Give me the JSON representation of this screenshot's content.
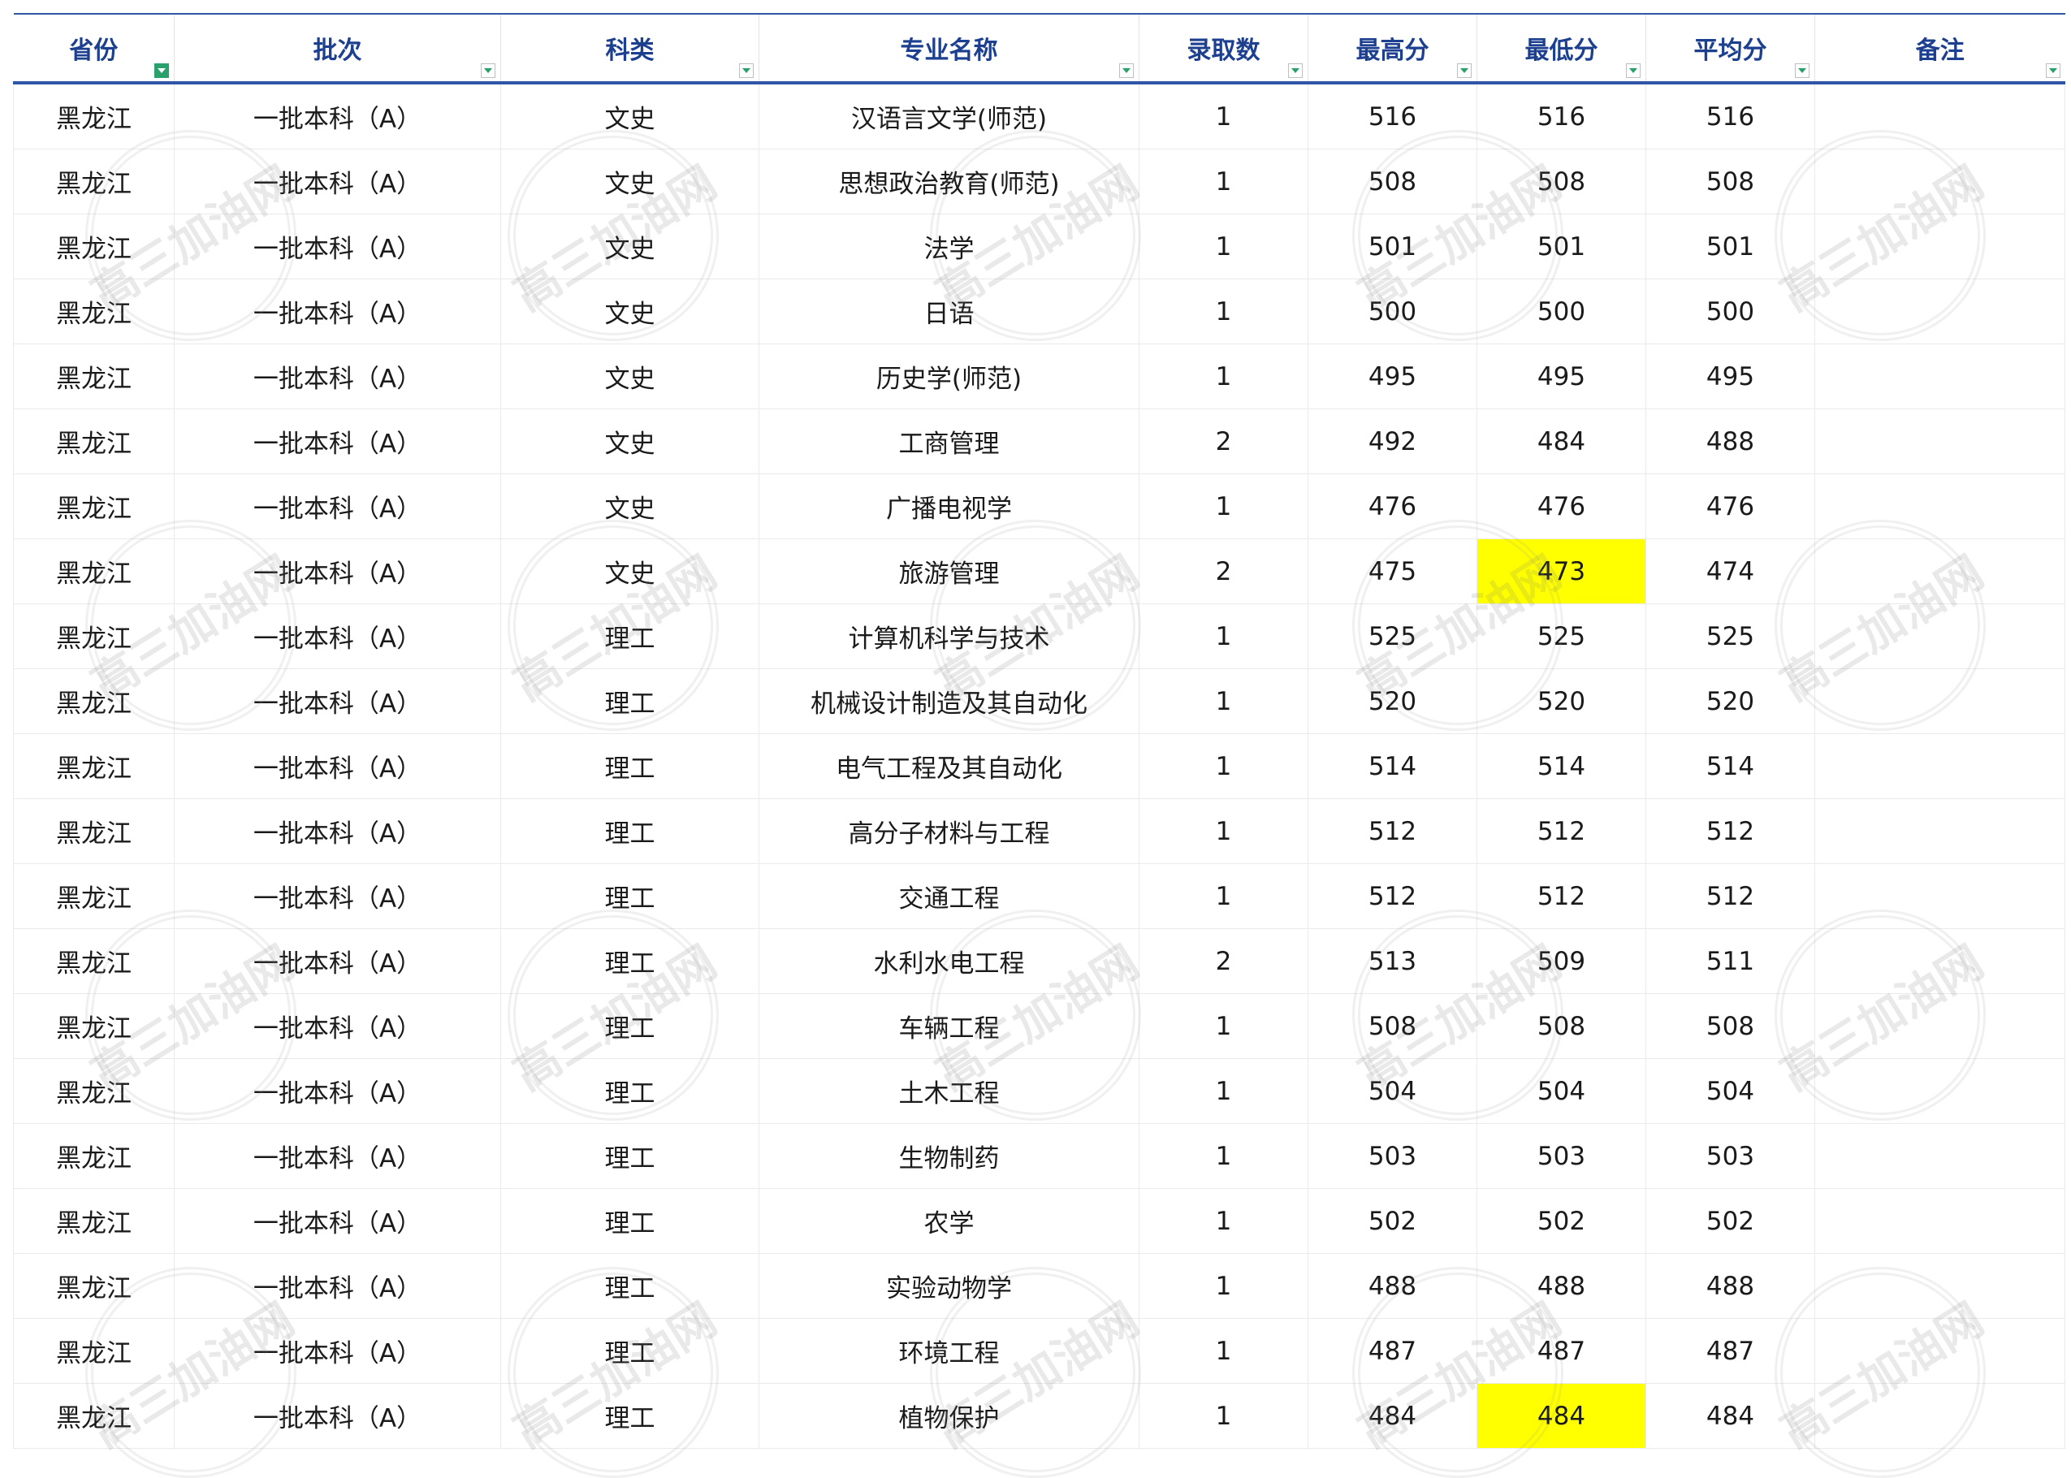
{
  "headers": [
    "省份",
    "批次",
    "科类",
    "专业名称",
    "录取数",
    "最高分",
    "最低分",
    "平均分",
    "备注"
  ],
  "watermark_text": "高三加油网",
  "highlight_color": "#ffff00",
  "rows": [
    {
      "province": "黑龙江",
      "batch": "一批本科（A）",
      "category": "文史",
      "major": "汉语言文学(师范)",
      "count": "1",
      "max": "516",
      "min": "516",
      "avg": "516",
      "note": "",
      "hl_min": false
    },
    {
      "province": "黑龙江",
      "batch": "一批本科（A）",
      "category": "文史",
      "major": "思想政治教育(师范)",
      "count": "1",
      "max": "508",
      "min": "508",
      "avg": "508",
      "note": "",
      "hl_min": false
    },
    {
      "province": "黑龙江",
      "batch": "一批本科（A）",
      "category": "文史",
      "major": "法学",
      "count": "1",
      "max": "501",
      "min": "501",
      "avg": "501",
      "note": "",
      "hl_min": false
    },
    {
      "province": "黑龙江",
      "batch": "一批本科（A）",
      "category": "文史",
      "major": "日语",
      "count": "1",
      "max": "500",
      "min": "500",
      "avg": "500",
      "note": "",
      "hl_min": false
    },
    {
      "province": "黑龙江",
      "batch": "一批本科（A）",
      "category": "文史",
      "major": "历史学(师范)",
      "count": "1",
      "max": "495",
      "min": "495",
      "avg": "495",
      "note": "",
      "hl_min": false
    },
    {
      "province": "黑龙江",
      "batch": "一批本科（A）",
      "category": "文史",
      "major": "工商管理",
      "count": "2",
      "max": "492",
      "min": "484",
      "avg": "488",
      "note": "",
      "hl_min": false
    },
    {
      "province": "黑龙江",
      "batch": "一批本科（A）",
      "category": "文史",
      "major": "广播电视学",
      "count": "1",
      "max": "476",
      "min": "476",
      "avg": "476",
      "note": "",
      "hl_min": false
    },
    {
      "province": "黑龙江",
      "batch": "一批本科（A）",
      "category": "文史",
      "major": "旅游管理",
      "count": "2",
      "max": "475",
      "min": "473",
      "avg": "474",
      "note": "",
      "hl_min": true
    },
    {
      "province": "黑龙江",
      "batch": "一批本科（A）",
      "category": "理工",
      "major": "计算机科学与技术",
      "count": "1",
      "max": "525",
      "min": "525",
      "avg": "525",
      "note": "",
      "hl_min": false
    },
    {
      "province": "黑龙江",
      "batch": "一批本科（A）",
      "category": "理工",
      "major": "机械设计制造及其自动化",
      "count": "1",
      "max": "520",
      "min": "520",
      "avg": "520",
      "note": "",
      "hl_min": false
    },
    {
      "province": "黑龙江",
      "batch": "一批本科（A）",
      "category": "理工",
      "major": "电气工程及其自动化",
      "count": "1",
      "max": "514",
      "min": "514",
      "avg": "514",
      "note": "",
      "hl_min": false
    },
    {
      "province": "黑龙江",
      "batch": "一批本科（A）",
      "category": "理工",
      "major": "高分子材料与工程",
      "count": "1",
      "max": "512",
      "min": "512",
      "avg": "512",
      "note": "",
      "hl_min": false
    },
    {
      "province": "黑龙江",
      "batch": "一批本科（A）",
      "category": "理工",
      "major": "交通工程",
      "count": "1",
      "max": "512",
      "min": "512",
      "avg": "512",
      "note": "",
      "hl_min": false
    },
    {
      "province": "黑龙江",
      "batch": "一批本科（A）",
      "category": "理工",
      "major": "水利水电工程",
      "count": "2",
      "max": "513",
      "min": "509",
      "avg": "511",
      "note": "",
      "hl_min": false
    },
    {
      "province": "黑龙江",
      "batch": "一批本科（A）",
      "category": "理工",
      "major": "车辆工程",
      "count": "1",
      "max": "508",
      "min": "508",
      "avg": "508",
      "note": "",
      "hl_min": false
    },
    {
      "province": "黑龙江",
      "batch": "一批本科（A）",
      "category": "理工",
      "major": "土木工程",
      "count": "1",
      "max": "504",
      "min": "504",
      "avg": "504",
      "note": "",
      "hl_min": false
    },
    {
      "province": "黑龙江",
      "batch": "一批本科（A）",
      "category": "理工",
      "major": "生物制药",
      "count": "1",
      "max": "503",
      "min": "503",
      "avg": "503",
      "note": "",
      "hl_min": false
    },
    {
      "province": "黑龙江",
      "batch": "一批本科（A）",
      "category": "理工",
      "major": "农学",
      "count": "1",
      "max": "502",
      "min": "502",
      "avg": "502",
      "note": "",
      "hl_min": false
    },
    {
      "province": "黑龙江",
      "batch": "一批本科（A）",
      "category": "理工",
      "major": "实验动物学",
      "count": "1",
      "max": "488",
      "min": "488",
      "avg": "488",
      "note": "",
      "hl_min": false
    },
    {
      "province": "黑龙江",
      "batch": "一批本科（A）",
      "category": "理工",
      "major": "环境工程",
      "count": "1",
      "max": "487",
      "min": "487",
      "avg": "487",
      "note": "",
      "hl_min": false
    },
    {
      "province": "黑龙江",
      "batch": "一批本科（A）",
      "category": "理工",
      "major": "植物保护",
      "count": "1",
      "max": "484",
      "min": "484",
      "avg": "484",
      "note": "",
      "hl_min": true
    }
  ]
}
